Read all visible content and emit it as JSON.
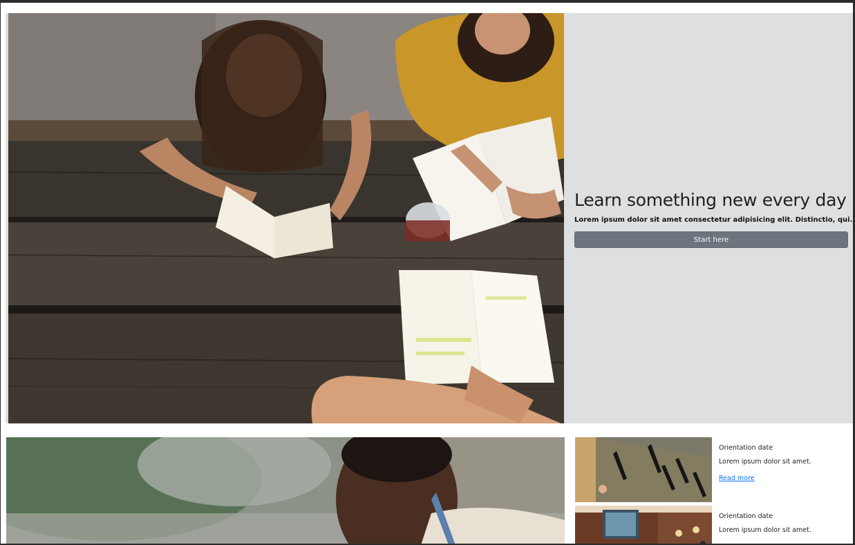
{
  "hero": {
    "title": "Learn something new every day",
    "subtitle": "Lorem ipsum dolor sit amet consectetur adipisicing elit. Distinctio, qui.",
    "button_label": "Start here"
  },
  "cards": [
    {
      "title": "Orientation date",
      "text": "Lorem ipsum dolor sit amet.",
      "link_label": "Read more"
    },
    {
      "title": "Orientation date",
      "text": "Lorem ipsum dolor sit amet."
    }
  ],
  "colors": {
    "hero_panel": "#dedfe1",
    "button": "#6c757d",
    "link": "#0d6efd"
  }
}
